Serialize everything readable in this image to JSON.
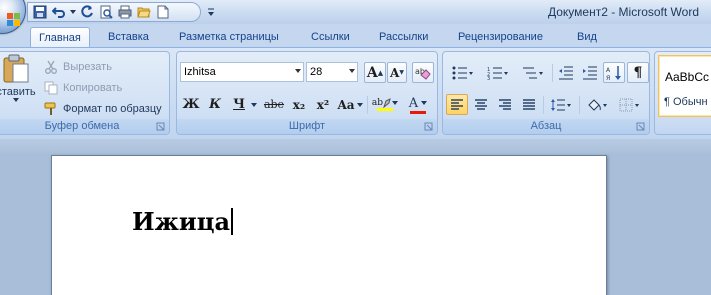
{
  "window": {
    "title": "Документ2 - Microsoft Word"
  },
  "quick_access": {
    "buttons": [
      "save-icon",
      "undo-icon",
      "redo-icon",
      "print-preview-icon",
      "print-icon",
      "open-icon",
      "new-document-icon"
    ],
    "customize_icon": "qat-customize-icon"
  },
  "tabs": [
    "Главная",
    "Вставка",
    "Разметка страницы",
    "Ссылки",
    "Рассылки",
    "Рецензирование",
    "Вид"
  ],
  "active_tab": "Главная",
  "clipboard": {
    "paste_label": "Вставить",
    "paste_visible_label": "ставить",
    "cut_label": "Вырезать",
    "copy_label": "Копировать",
    "format_painter_label": "Формат по образцу",
    "group_label": "Буфер обмена"
  },
  "font": {
    "font_name": "Izhitsa",
    "font_size": "28",
    "bold_label": "Ж",
    "italic_label": "К",
    "underline_label": "Ч",
    "strike_label": "abe",
    "subscript_label": "x₂",
    "superscript_label": "x²",
    "case_label": "Aa",
    "grow_label": "A",
    "shrink_label": "A",
    "highlight_label": "ab",
    "font_color_label": "A",
    "group_label": "Шрифт"
  },
  "paragraph": {
    "group_label": "Абзац"
  },
  "styles": {
    "sample_text": "AaBbCc",
    "style_name": "¶ Обычн"
  },
  "document": {
    "text": "Ижица"
  },
  "colors": {
    "accent": "#ffd263",
    "font_color_bar": "#e8190b",
    "highlight_bar": "#ffff00",
    "tab_text": "#15428b"
  }
}
